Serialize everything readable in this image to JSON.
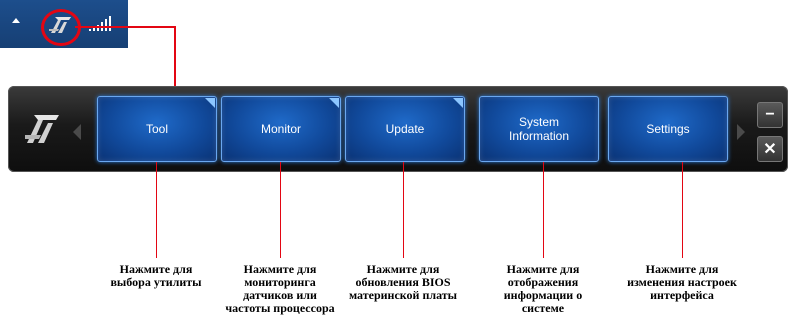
{
  "tray": {
    "up_arrow_icon": "triangle-up-icon",
    "app_icon": "ai-suite-logo-icon",
    "signal_icon": "signal-bars-icon",
    "highlight_color": "#e30613"
  },
  "toolbar": {
    "logo_icon": "ai-suite-logo-icon",
    "buttons": [
      {
        "label": "Tool"
      },
      {
        "label": "Monitor"
      },
      {
        "label": "Update"
      },
      {
        "label": "System\nInformation"
      },
      {
        "label": "Settings"
      }
    ],
    "minimize_label": "−",
    "close_label": "✕",
    "button_color": "#1656b0",
    "callout_color": "#e30613"
  },
  "captions": [
    "Нажмите для\nвыбора утилиты",
    "Нажмите для\nмониторинга\nдатчиков или\nчастоты процессора",
    "Нажмите для\nобновления BIOS\nматеринской платы",
    "Нажмите для\nотображения\nинформации о\nсистеме",
    "Нажмите для\nизменения настроек\nинтерфейса"
  ]
}
